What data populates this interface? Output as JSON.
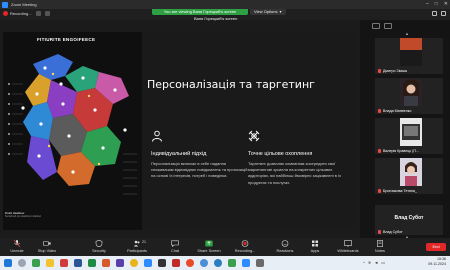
{
  "window": {
    "title": "Zoom Meeting"
  },
  "topbar": {
    "recording_label": "Recording...",
    "viewing_banner": "You are viewing Ваня Горецкий's screen",
    "view_options": "View Options",
    "screen_owner": "Ваня Горецкий's screen"
  },
  "slide": {
    "map_title": "FITIURITE ENGOIFEECE",
    "map_caption_title": "Finals Headboer",
    "map_caption": "Sertelinah pro deahtrunn Eddnel",
    "title": "Персоналізація та таргетинг",
    "col1": {
      "icon": "person-icon",
      "heading": "Індивідуальний підхід",
      "text": "Персоналізація включає в себе надання споживачам відповідних повідомлень та пропозицій на основі їх інтересів, потреб і поведінки."
    },
    "col2": {
      "icon": "target-cross-icon",
      "heading": "Точне цільове охоплення",
      "text": "Таргетинг дозволяє компаніям зосередити свої маркетингові зусилля на конкретних цільових аудиторіях, які найбільш ймовірно зацікавлені в їх продуктах та послугах."
    }
  },
  "participants": [
    {
      "name": "Дмитро Зімша",
      "muted": true
    },
    {
      "name": "Влада Матвієнко",
      "muted": true
    },
    {
      "name": "Валерія Кравець (П...",
      "muted": true
    },
    {
      "name": "Бронзакова Тетяна_",
      "muted": true
    },
    {
      "name": "Влад Субот",
      "display_name": "Влад Субот",
      "muted": true
    }
  ],
  "toolbar": {
    "items": [
      {
        "label": "Unmute",
        "icon": "microphone-icon"
      },
      {
        "label": "Stop Video",
        "icon": "video-camera-icon"
      },
      {
        "label": "Security",
        "icon": "shield-icon"
      },
      {
        "label": "Participants",
        "icon": "participants-icon",
        "count": "21"
      },
      {
        "label": "Chat",
        "icon": "chat-icon"
      },
      {
        "label": "Share Screen",
        "icon": "share-screen-icon"
      },
      {
        "label": "Record",
        "icon": "record-icon"
      },
      {
        "label": "Reactions",
        "icon": "reactions-icon"
      },
      {
        "label": "Apps",
        "icon": "apps-icon"
      },
      {
        "label": "Whiteboards",
        "icon": "whiteboard-icon"
      },
      {
        "label": "Notes",
        "icon": "notes-icon"
      }
    ],
    "end_label": "End",
    "recording_label": "Recording..."
  },
  "taskbar": {
    "time": "15:36",
    "date": "09.11.2024",
    "apps": [
      "start",
      "search",
      "file-explorer",
      "acrobat",
      "word",
      "excel",
      "chrome",
      "edge",
      "zoom",
      "other"
    ]
  },
  "colors": {
    "accent_green": "#2ea043",
    "record_red": "#e02828",
    "zoom_blue": "#2d8cff",
    "slide_bg": "#1a1a1a"
  }
}
